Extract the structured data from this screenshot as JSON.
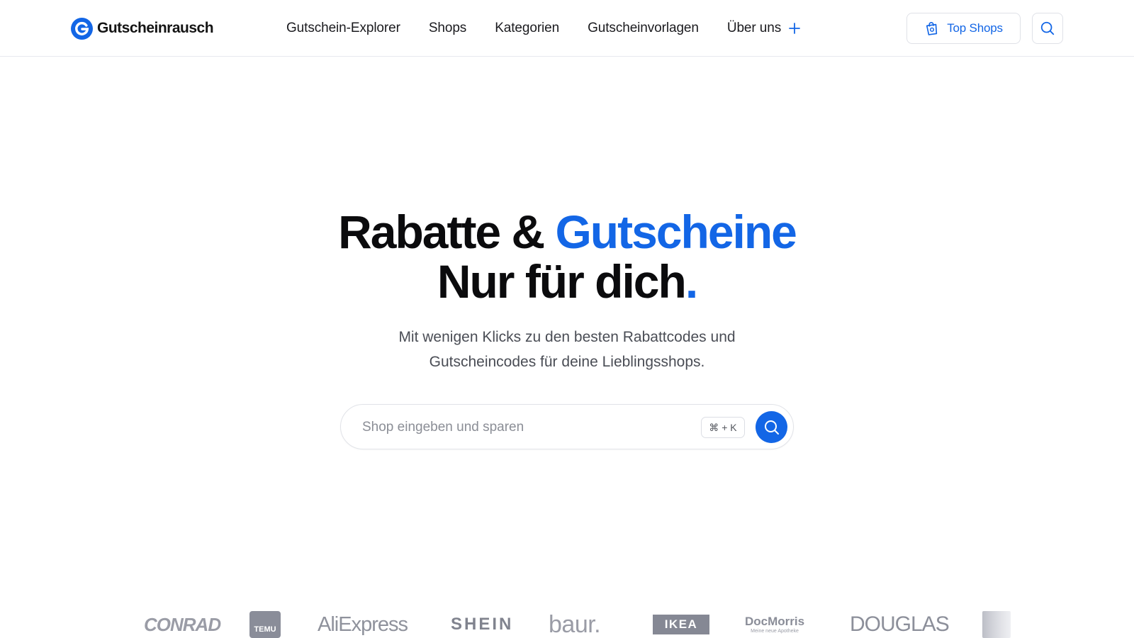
{
  "brand": {
    "name": "Gutscheinrausch",
    "accent": "#1366e6"
  },
  "nav": {
    "items": [
      "Gutschein-Explorer",
      "Shops",
      "Kategorien",
      "Gutscheinvorlagen",
      "Über uns"
    ]
  },
  "header": {
    "top_shops_label": "Top Shops"
  },
  "hero": {
    "title_part1": "Rabatte & ",
    "title_accent": "Gutscheine",
    "title_line2": "Nur für dich",
    "title_dot": ".",
    "subtitle_line1": "Mit wenigen Klicks zu den besten Rabattcodes und",
    "subtitle_line2": "Gutscheincodes für deine Lieblingsshops."
  },
  "search": {
    "placeholder": "Shop eingeben und sparen",
    "shortcut": "⌘ + K"
  },
  "shop_logos": [
    "CONRAD",
    "TEMU",
    "AliExpress",
    "SHEIN",
    "baur.",
    "IKEA",
    "DocMorris",
    "DOUGLAS"
  ],
  "shop_logo_extra": {
    "docmorris_tagline": "Meine neue Apotheke"
  }
}
